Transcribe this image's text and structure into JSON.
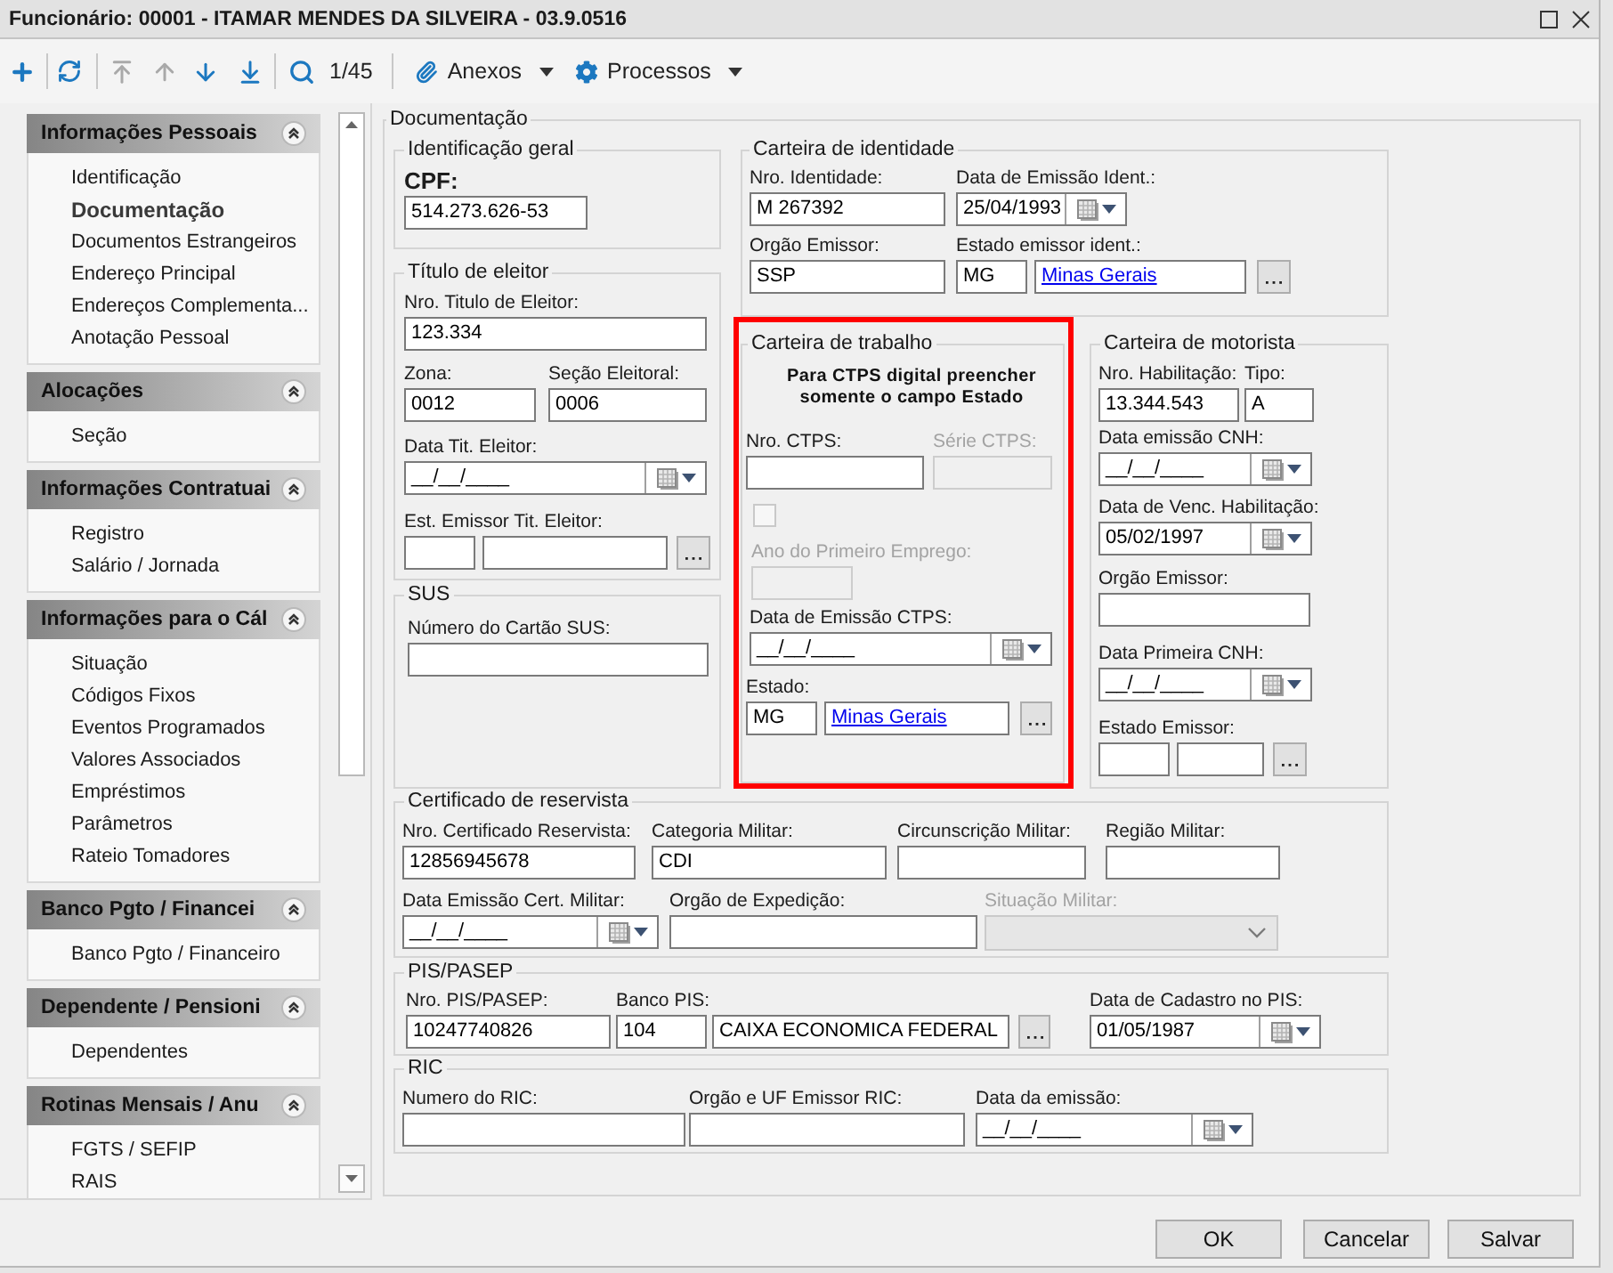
{
  "window": {
    "title": "Funcionário: 00001 - ITAMAR MENDES DA SILVEIRA - 03.9.0516"
  },
  "toolbar": {
    "navigation": [
      {
        "disabled": true
      },
      {
        "disabled": true
      },
      {
        "disabled": false
      },
      {
        "disabled": false
      }
    ],
    "record_position": "1/45",
    "menus": [
      {
        "label": "Anexos"
      },
      {
        "label": "Processos"
      }
    ]
  },
  "sidebar": {
    "sections": [
      {
        "title": "Informações Pessoais",
        "expanded": true,
        "items": [
          {
            "label": "Identificação",
            "selected": false
          },
          {
            "label": "Documentação",
            "selected": true
          },
          {
            "label": "Documentos Estrangeiros",
            "selected": false
          },
          {
            "label": "Endereço Principal",
            "selected": false
          },
          {
            "label": "Endereços Complementa...",
            "selected": false
          },
          {
            "label": "Anotação Pessoal",
            "selected": false
          }
        ]
      },
      {
        "title": "Alocações",
        "expanded": true,
        "items": [
          {
            "label": "Seção",
            "selected": false
          }
        ]
      },
      {
        "title": "Informações Contratuai",
        "expanded": true,
        "items": [
          {
            "label": "Registro",
            "selected": false
          },
          {
            "label": "Salário / Jornada",
            "selected": false
          }
        ]
      },
      {
        "title": "Informações para o Cál",
        "expanded": true,
        "items": [
          {
            "label": "Situação",
            "selected": false
          },
          {
            "label": "Códigos Fixos",
            "selected": false
          },
          {
            "label": "Eventos Programados",
            "selected": false
          },
          {
            "label": "Valores Associados",
            "selected": false
          },
          {
            "label": "Empréstimos",
            "selected": false
          },
          {
            "label": "Parâmetros",
            "selected": false
          },
          {
            "label": "Rateio Tomadores",
            "selected": false
          }
        ]
      },
      {
        "title": "Banco Pgto / Financei",
        "expanded": true,
        "items": [
          {
            "label": "Banco Pgto / Financeiro",
            "selected": false
          }
        ]
      },
      {
        "title": "Dependente / Pensioni",
        "expanded": true,
        "items": [
          {
            "label": "Dependentes",
            "selected": false
          }
        ]
      },
      {
        "title": "Rotinas Mensais / Anu",
        "expanded": true,
        "items": [
          {
            "label": "FGTS / SEFIP",
            "selected": false
          },
          {
            "label": "RAIS",
            "selected": false
          }
        ]
      }
    ]
  },
  "documentation": {
    "title": "Documentação",
    "general_id": {
      "title": "Identificação geral",
      "cpf": {
        "label": "CPF:",
        "value": "514.273.626-53"
      }
    },
    "voter_card": {
      "title": "Título de eleitor",
      "number": {
        "label": "Nro. Titulo de Eleitor:",
        "value": "123.334"
      },
      "zone": {
        "label": "Zona:",
        "value": "0012"
      },
      "section": {
        "label": "Seção Eleitoral:",
        "value": "0006"
      },
      "date": {
        "label": "Data Tit. Eleitor:",
        "value": "__/__/____"
      },
      "issuer_state": {
        "label": "Est. Emissor Tit. Eleitor:"
      }
    },
    "sus": {
      "title": "SUS",
      "card_number": {
        "label": "Número do Cartão SUS:"
      }
    },
    "identity_card": {
      "title": "Carteira de identidade",
      "number": {
        "label": "Nro. Identidade:",
        "value": "M 267392"
      },
      "issue_date": {
        "label": "Data de Emissão Ident.:",
        "value": "25/04/1993"
      },
      "issuer": {
        "label": "Orgão Emissor:",
        "value": "SSP"
      },
      "issuer_state": {
        "label": "Estado emissor ident.:",
        "code": "MG",
        "name": "Minas Gerais"
      }
    },
    "work_card": {
      "title": "Carteira de trabalho",
      "highlighted": true,
      "note": "Para CTPS digital preencher somente o campo Estado",
      "number": {
        "label": "Nro. CTPS:"
      },
      "series": {
        "label": "Série CTPS:",
        "disabled": true
      },
      "checkbox": {
        "checked": false,
        "disabled": true
      },
      "first_job_year": {
        "label": "Ano do Primeiro Emprego:",
        "disabled": true
      },
      "issue_date": {
        "label": "Data de Emissão CTPS:",
        "value": "__/__/____"
      },
      "state": {
        "label": "Estado:",
        "code": "MG",
        "name": "Minas Gerais"
      }
    },
    "driver_license": {
      "title": "Carteira de motorista",
      "number": {
        "label": "Nro. Habilitação:",
        "value": "13.344.543"
      },
      "type": {
        "label": "Tipo:",
        "value": "A"
      },
      "issue_date": {
        "label": "Data emissão CNH:",
        "value": "__/__/____"
      },
      "expiry_date": {
        "label": "Data de Venc. Habilitação:",
        "value": "05/02/1997"
      },
      "issuer": {
        "label": "Orgão Emissor:"
      },
      "first_license_date": {
        "label": "Data Primeira CNH:",
        "value": "__/__/____"
      },
      "issuer_state": {
        "label": "Estado Emissor:"
      }
    },
    "reservist": {
      "title": "Certificado de reservista",
      "number": {
        "label": "Nro. Certificado Reservista:",
        "value": "12856945678"
      },
      "category": {
        "label": "Categoria Militar:",
        "value": "CDI"
      },
      "district": {
        "label": "Circunscrição Militar:"
      },
      "region": {
        "label": "Região Militar:"
      },
      "issue_date": {
        "label": "Data Emissão Cert. Militar:",
        "value": "__/__/____"
      },
      "issuing_body": {
        "label": "Orgão de Expedição:"
      },
      "status": {
        "label": "Situação Militar:",
        "disabled": true
      }
    },
    "pis": {
      "title": "PIS/PASEP",
      "number": {
        "label": "Nro. PIS/PASEP:",
        "value": "10247740826"
      },
      "bank": {
        "label": "Banco PIS:",
        "code": "104",
        "name": "CAIXA ECONOMICA FEDERAL"
      },
      "registration_date": {
        "label": "Data de Cadastro no PIS:",
        "value": "01/05/1987"
      }
    },
    "ric": {
      "title": "RIC",
      "number": {
        "label": "Numero do RIC:"
      },
      "issuer": {
        "label": "Orgão e UF Emissor RIC:"
      },
      "issue_date": {
        "label": "Data da emissão:",
        "value": "__/__/____"
      }
    }
  },
  "buttons": [
    {
      "label": "OK"
    },
    {
      "label": "Cancelar"
    },
    {
      "label": "Salvar"
    }
  ]
}
